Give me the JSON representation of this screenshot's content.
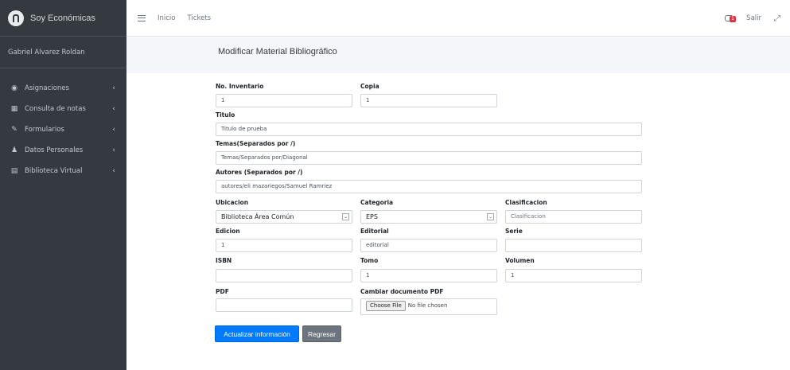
{
  "brand": {
    "name": "Soy Económicas"
  },
  "user": {
    "name": "Gabriel Alvarez Roldan"
  },
  "sidebar": {
    "items": [
      {
        "label": "Asignaciones",
        "icon": "palette-icon"
      },
      {
        "label": "Consulta de notas",
        "icon": "table-icon"
      },
      {
        "label": "Formularios",
        "icon": "edit-icon"
      },
      {
        "label": "Datos Personales",
        "icon": "person-icon"
      },
      {
        "label": "Biblioteca Virtual",
        "icon": "book-icon"
      }
    ]
  },
  "topbar": {
    "links": [
      "Inicio",
      "Tickets"
    ],
    "badge": "1",
    "logout": "Salir"
  },
  "page": {
    "title": "Modificar Material Bibliográfico"
  },
  "form": {
    "inventario": {
      "label": "No. Inventario",
      "value": "1"
    },
    "copia": {
      "label": "Copia",
      "value": "1"
    },
    "titulo": {
      "label": "Titulo",
      "value": "Titulo de prueba"
    },
    "temas": {
      "label": "Temas(Separados por /)",
      "value": "Temas/Separados por/Diagonal"
    },
    "autores": {
      "label": "Autores (Separados por /)",
      "value": "autores/eli mazariegos/Samuel Ramriez"
    },
    "ubicacion": {
      "label": "Ubicacion",
      "value": "Biblioteca Área Común"
    },
    "categoria": {
      "label": "Categoria",
      "value": "EPS"
    },
    "clasificacion": {
      "label": "Clasificacion",
      "placeholder": "Clasificacion"
    },
    "edicion": {
      "label": "Edicion",
      "value": "1"
    },
    "editorial": {
      "label": "Editorial",
      "value": "editorial"
    },
    "serie": {
      "label": "Serie",
      "value": ""
    },
    "isbn": {
      "label": "ISBN",
      "value": ""
    },
    "tomo": {
      "label": "Tomo",
      "value": "1"
    },
    "volumen": {
      "label": "Volumen",
      "value": "1"
    },
    "pdf": {
      "label": "PDF",
      "value": ""
    },
    "cambiar_pdf": {
      "label": "Cambiar documento PDF",
      "button": "Choose File",
      "status": "No file chosen"
    },
    "submit": "Actualizar información",
    "back": "Regresar"
  },
  "colors": {
    "sidebar": "#343a40",
    "primary": "#007bff",
    "secondary": "#6c757d",
    "badge": "#dc3545"
  }
}
